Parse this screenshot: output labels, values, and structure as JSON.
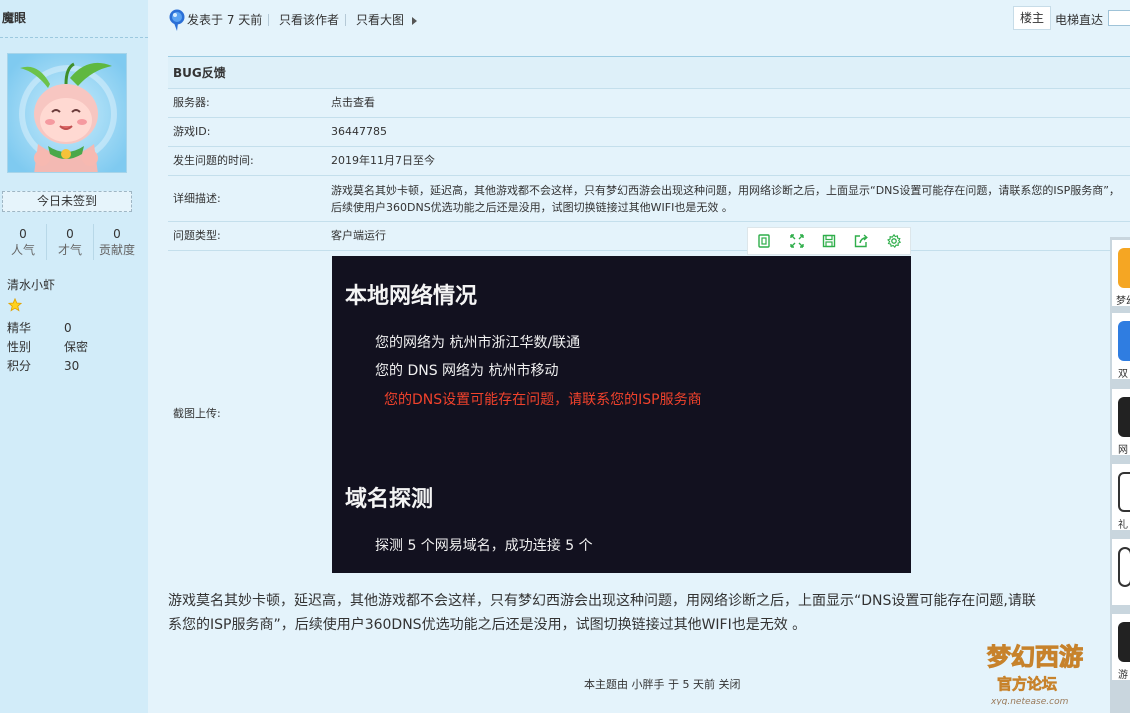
{
  "sidebar": {
    "username": "魔眼",
    "sign_in": "今日未签到",
    "stats": [
      {
        "value": "0",
        "label": "人气"
      },
      {
        "value": "0",
        "label": "才气"
      },
      {
        "value": "0",
        "label": "贡献度"
      }
    ],
    "user_title": "清水小虾",
    "info": [
      {
        "key": "精华",
        "value": "0"
      },
      {
        "key": "性别",
        "value": "保密"
      },
      {
        "key": "积分",
        "value": "30"
      }
    ]
  },
  "topbar": {
    "posted": "发表于 7 天前",
    "only_author": "只看该作者",
    "big_image": "只看大图",
    "floor": "楼主",
    "elevator": "电梯直达"
  },
  "form": {
    "title": "BUG反馈",
    "rows": [
      {
        "label": "服务器:",
        "value": "点击查看"
      },
      {
        "label": "游戏ID:",
        "value": "36447785"
      },
      {
        "label": "发生问题的时间:",
        "value": "2019年11月7日至今"
      },
      {
        "label": "详细描述:",
        "value": "游戏莫名其妙卡顿，延迟高，其他游戏都不会这样，只有梦幻西游会出现这种问题，用网络诊断之后，上面显示“DNS设置可能存在问题，请联系您的ISP服务商”，后续使用户360DNS优选功能之后还是没用，试图切换链接过其他WIFI也是无效 。"
      },
      {
        "label": "问题类型:",
        "value": "客户端运行"
      }
    ],
    "upload_label": "截图上传:"
  },
  "screenshot": {
    "heading1": "本地网络情况",
    "line1": "您的网络为 杭州市浙江华数/联通",
    "line2": "您的 DNS 网络为 杭州市移动",
    "warning": "您的DNS设置可能存在问题，请联系您的ISP服务商",
    "heading2": "域名探测",
    "line3": "探测 5 个网易域名，成功连接 5 个"
  },
  "post_body": {
    "line1": "游戏莫名其妙卡顿，延迟高，其他游戏都不会这样，只有梦幻西游会出现这种问题，用网络诊断之后，上面显示“DNS设置可能存在问题,请联",
    "line2": "系您的ISP服务商”，后续使用户360DNS优选功能之后还是没用，试图切换链接过其他WIFI也是无效 。"
  },
  "closed_note": "本主题由 小胖手 于 5 天前 关闭",
  "right_bar": [
    {
      "label": "梦幻",
      "color": "#f5a623"
    },
    {
      "label": "双",
      "color": "#2f7de1"
    },
    {
      "label": "网",
      "color": "#222222"
    },
    {
      "label": "礼",
      "color": "#333333"
    },
    {
      "label": "",
      "color": "#333333"
    },
    {
      "label": "游",
      "color": "#222222"
    }
  ],
  "watermark": {
    "line1": "梦幻西游",
    "line2": "官方论坛",
    "url": "xyq.netease.com"
  }
}
